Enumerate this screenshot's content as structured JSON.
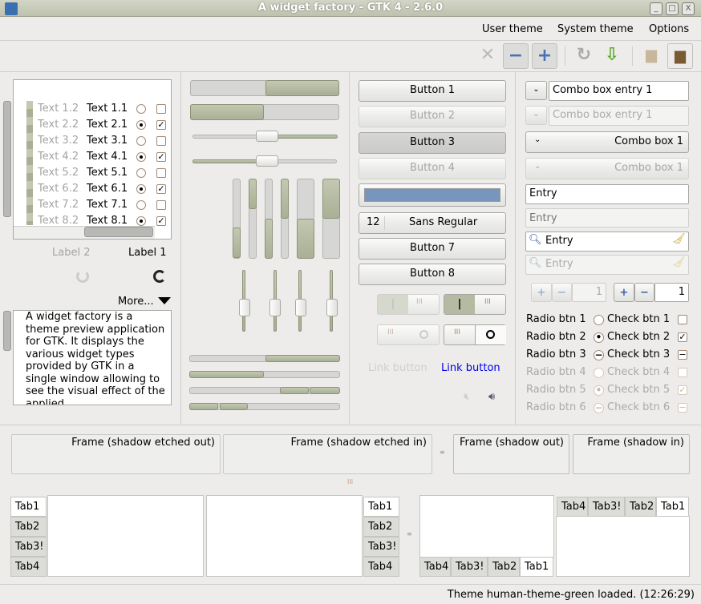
{
  "window": {
    "title": "A widget factory - GTK 4 - 2.6.0",
    "controls": [
      "_",
      "□",
      "X"
    ]
  },
  "menu": [
    "User theme",
    "System theme",
    "Options"
  ],
  "toolbar": {
    "icons": [
      "close-icon",
      "zoom-out-icon",
      "zoom-in-icon",
      "refresh-icon",
      "download-icon",
      "folder-icon",
      "folder-open-icon"
    ]
  },
  "tree": {
    "rows": [
      [
        "Text 1.2",
        "Text 1.1",
        false,
        false
      ],
      [
        "Text 2.2",
        "Text 2.1",
        true,
        true
      ],
      [
        "Text 3.2",
        "Text 3.1",
        false,
        false
      ],
      [
        "Text 4.2",
        "Text 4.1",
        true,
        true
      ],
      [
        "Text 5.2",
        "Text 5.1",
        false,
        false
      ],
      [
        "Text 6.2",
        "Text 6.1",
        true,
        true
      ],
      [
        "Text 7.2",
        "Text 7.1",
        false,
        false
      ],
      [
        "Text 8.2",
        "Text 8.1",
        true,
        true
      ]
    ]
  },
  "labels": {
    "label2": "Label 2",
    "label1": "Label 1",
    "more": "More..."
  },
  "textview": "A widget factory is a theme preview application for GTK. It displays the various widget types provided by GTK in a single window allowing to see the visual effect of the applied",
  "progress": {
    "bar1": 0.5,
    "bar2": 0.5,
    "scale1": 0.5,
    "scale2": 0.5
  },
  "buttons": {
    "b1": "Button 1",
    "b2": "Button 2",
    "b3": "Button 3",
    "b4": "Button 4",
    "color": "#7896bb",
    "font_size": "12",
    "font_name": "Sans Regular",
    "b7": "Button 7",
    "b8": "Button 8",
    "link_disabled": "Link button",
    "link": "Link button",
    "link_color": "#0000ee"
  },
  "inputs": {
    "combo_entry1": "Combo box entry 1",
    "combo_entry2": "Combo box entry 1",
    "combo1": "Combo box 1",
    "combo2": "Combo box 1",
    "entry1": "Entry",
    "entry2_placeholder": "Entry",
    "search1": "Entry",
    "search2_placeholder": "Entry",
    "spin1": "1",
    "spin2": "1"
  },
  "radios": [
    "Radio btn 1",
    "Radio btn 2",
    "Radio btn 3",
    "Radio btn 4",
    "Radio btn 5",
    "Radio btn 6"
  ],
  "checks": [
    "Check btn 1",
    "Check btn 2",
    "Check btn 3",
    "Check btn 4",
    "Check btn 5",
    "Check btn 6"
  ],
  "frames": [
    "Frame (shadow etched out)",
    "Frame (shadow etched in)",
    "Frame (shadow out)",
    "Frame (shadow in)"
  ],
  "tabs": {
    "left": [
      "Tab1",
      "Tab2",
      "Tab3!",
      "Tab4"
    ],
    "right": [
      "Tab1",
      "Tab2",
      "Tab3!",
      "Tab4"
    ],
    "bottom": [
      "Tab4",
      "Tab3!",
      "Tab2",
      "Tab1"
    ],
    "top": [
      "Tab4",
      "Tab3!",
      "Tab2",
      "Tab1"
    ]
  },
  "status": "Theme human-theme-green loaded.  (12:26:29)"
}
